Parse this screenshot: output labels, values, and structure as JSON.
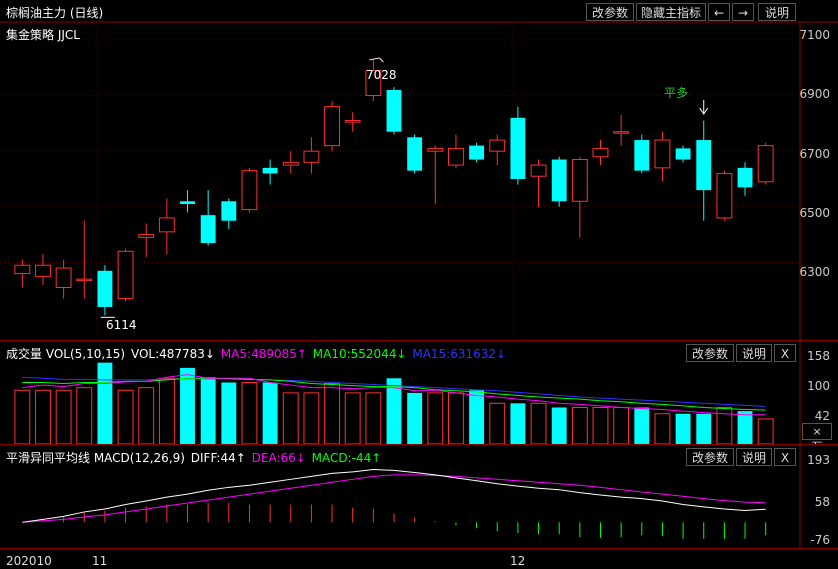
{
  "main": {
    "title": "棕榈油主力 (日线)",
    "strategy": "集金策略 JJCL",
    "buttons": [
      "改参数",
      "隐藏主指标",
      "←",
      "→",
      "说明"
    ],
    "y_ticks": [
      "7100",
      "6900",
      "6700",
      "6500",
      "6300"
    ],
    "high_label": "7028",
    "low_label": "6114",
    "signal_label": "平多",
    "signal_color": "#22cc22"
  },
  "volume": {
    "title": "成交量 VOL(5,10,15)",
    "vol_label": "VOL:487783↓",
    "ma5_label": "MA5:489085↑",
    "ma10_label": "MA10:552044↓",
    "ma15_label": "MA15:631632↓",
    "buttons": [
      "改参数",
      "说明",
      "X"
    ],
    "y_ticks": [
      "158",
      "100",
      "42"
    ],
    "unit": "×万"
  },
  "macd": {
    "title": "平滑异同平均线 MACD(12,26,9)",
    "diff_label": "DIFF:44↑",
    "dea_label": "DEA:66↓",
    "macd_label": "MACD:-44↑",
    "buttons": [
      "改参数",
      "说明",
      "X"
    ],
    "y_ticks": [
      "193",
      "58",
      "-76"
    ]
  },
  "dates": {
    "start": "202010",
    "m11": "11",
    "m12": "12"
  },
  "colors": {
    "up": "#ff3030",
    "down": "#00ffff",
    "ma5": "#ff00ff",
    "ma10": "#00ff00",
    "ma15": "#3030ff",
    "diff": "#ffffff",
    "dea": "#ff00ff",
    "grid": "#8b0000"
  },
  "chart_data": {
    "type": "candlestick",
    "y_range": [
      6050,
      7150
    ],
    "candles": [
      {
        "o": 6260,
        "c": 6290,
        "h": 6310,
        "l": 6210
      },
      {
        "o": 6250,
        "c": 6290,
        "h": 6330,
        "l": 6220
      },
      {
        "o": 6210,
        "c": 6280,
        "h": 6310,
        "l": 6170
      },
      {
        "o": 6240,
        "c": 6240,
        "h": 6450,
        "l": 6170
      },
      {
        "o": 6270,
        "c": 6140,
        "h": 6290,
        "l": 6110
      },
      {
        "o": 6170,
        "c": 6340,
        "h": 6350,
        "l": 6160
      },
      {
        "o": 6390,
        "c": 6400,
        "h": 6440,
        "l": 6320
      },
      {
        "o": 6410,
        "c": 6460,
        "h": 6530,
        "l": 6330
      },
      {
        "o": 6520,
        "c": 6510,
        "h": 6560,
        "l": 6480
      },
      {
        "o": 6470,
        "c": 6370,
        "h": 6560,
        "l": 6360
      },
      {
        "o": 6520,
        "c": 6450,
        "h": 6530,
        "l": 6420
      },
      {
        "o": 6490,
        "c": 6630,
        "h": 6640,
        "l": 6480
      },
      {
        "o": 6640,
        "c": 6620,
        "h": 6670,
        "l": 6580
      },
      {
        "o": 6650,
        "c": 6660,
        "h": 6700,
        "l": 6620
      },
      {
        "o": 6660,
        "c": 6700,
        "h": 6750,
        "l": 6620
      },
      {
        "o": 6720,
        "c": 6860,
        "h": 6880,
        "l": 6700
      },
      {
        "o": 6810,
        "c": 6810,
        "h": 6840,
        "l": 6770
      },
      {
        "o": 6900,
        "c": 6990,
        "h": 7028,
        "l": 6880
      },
      {
        "o": 6920,
        "c": 6770,
        "h": 6930,
        "l": 6760
      },
      {
        "o": 6750,
        "c": 6630,
        "h": 6760,
        "l": 6620
      },
      {
        "o": 6700,
        "c": 6710,
        "h": 6720,
        "l": 6510
      },
      {
        "o": 6650,
        "c": 6710,
        "h": 6760,
        "l": 6640
      },
      {
        "o": 6720,
        "c": 6670,
        "h": 6730,
        "l": 6660
      },
      {
        "o": 6700,
        "c": 6740,
        "h": 6760,
        "l": 6650
      },
      {
        "o": 6820,
        "c": 6600,
        "h": 6860,
        "l": 6580
      },
      {
        "o": 6610,
        "c": 6650,
        "h": 6670,
        "l": 6500
      },
      {
        "o": 6670,
        "c": 6520,
        "h": 6680,
        "l": 6500
      },
      {
        "o": 6520,
        "c": 6670,
        "h": 6680,
        "l": 6390
      },
      {
        "o": 6680,
        "c": 6710,
        "h": 6740,
        "l": 6650
      },
      {
        "o": 6770,
        "c": 6770,
        "h": 6830,
        "l": 6720
      },
      {
        "o": 6740,
        "c": 6630,
        "h": 6760,
        "l": 6620
      },
      {
        "o": 6640,
        "c": 6740,
        "h": 6770,
        "l": 6590
      },
      {
        "o": 6710,
        "c": 6670,
        "h": 6720,
        "l": 6660
      },
      {
        "o": 6740,
        "c": 6560,
        "h": 6810,
        "l": 6450
      },
      {
        "o": 6460,
        "c": 6620,
        "h": 6630,
        "l": 6450
      },
      {
        "o": 6640,
        "c": 6570,
        "h": 6660,
        "l": 6540
      },
      {
        "o": 6590,
        "c": 6720,
        "h": 6730,
        "l": 6580
      }
    ],
    "volume": [
      105,
      105,
      105,
      110,
      158,
      105,
      110,
      128,
      148,
      130,
      120,
      120,
      120,
      100,
      100,
      118,
      100,
      100,
      128,
      100,
      100,
      100,
      105,
      80,
      80,
      80,
      72,
      72,
      72,
      72,
      72,
      60,
      60,
      60,
      72,
      65,
      50
    ],
    "vol_ma5": [
      110,
      115,
      112,
      118,
      118,
      121,
      122,
      130,
      135,
      128,
      128,
      128,
      120,
      115,
      110,
      110,
      108,
      110,
      110,
      104,
      105,
      100,
      95,
      92,
      88,
      85,
      80,
      78,
      75,
      72,
      70,
      68,
      65,
      62,
      60,
      58,
      58
    ],
    "vol_ma10": [
      120,
      120,
      118,
      120,
      120,
      122,
      122,
      125,
      128,
      128,
      127,
      126,
      125,
      122,
      118,
      116,
      114,
      112,
      112,
      110,
      106,
      104,
      102,
      98,
      95,
      92,
      90,
      88,
      85,
      83,
      80,
      78,
      75,
      72,
      70,
      68,
      67
    ],
    "vol_ma15": [
      130,
      128,
      126,
      126,
      125,
      125,
      125,
      126,
      127,
      127,
      127,
      126,
      125,
      124,
      122,
      120,
      118,
      116,
      114,
      112,
      110,
      108,
      106,
      104,
      101,
      98,
      95,
      92,
      90,
      88,
      86,
      84,
      82,
      80,
      78,
      76,
      74
    ],
    "macd_range": [
      -90,
      200
    ],
    "diff": [
      0,
      10,
      20,
      35,
      45,
      60,
      72,
      85,
      95,
      108,
      118,
      125,
      135,
      145,
      155,
      165,
      170,
      178,
      175,
      168,
      160,
      150,
      140,
      130,
      122,
      115,
      110,
      100,
      92,
      85,
      80,
      72,
      60,
      52,
      45,
      40,
      44
    ],
    "dea": [
      0,
      5,
      10,
      18,
      25,
      35,
      45,
      55,
      65,
      75,
      85,
      95,
      105,
      115,
      125,
      135,
      145,
      155,
      160,
      160,
      158,
      155,
      150,
      145,
      140,
      135,
      130,
      125,
      118,
      110,
      102,
      95,
      88,
      80,
      73,
      68,
      66
    ],
    "macd_hist": [
      -44,
      -44,
      -44,
      -44,
      -44,
      -44,
      -44,
      -44,
      -44,
      -44,
      -44,
      -44,
      -44,
      -44,
      -44,
      -44,
      -44,
      -44,
      -44,
      -44,
      -44,
      -44,
      -44,
      -44,
      -44,
      -44,
      -44,
      -44,
      -44,
      -44,
      -44,
      -44,
      -44,
      -44,
      -44,
      -44,
      -44
    ]
  }
}
